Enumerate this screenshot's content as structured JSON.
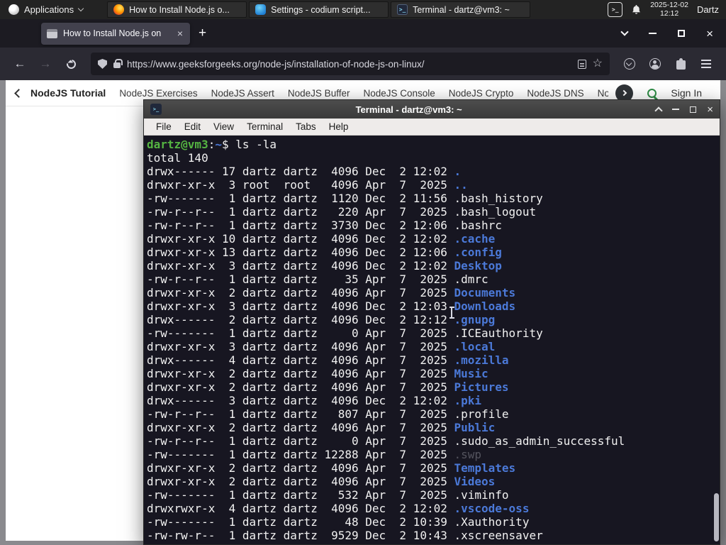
{
  "panel": {
    "applications_label": "Applications",
    "tasks": [
      {
        "title": "How to Install Node.js o...",
        "icon": "firefox-icon"
      },
      {
        "title": "Settings - codium script...",
        "icon": "settings-icon"
      },
      {
        "title": "Terminal - dartz@vm3: ~",
        "icon": "terminal-icon"
      }
    ],
    "clock_date": "2025-12-02",
    "clock_time": "12:12",
    "user_label": "Dartz"
  },
  "browser": {
    "tab": {
      "title": "How to Install Node.js on",
      "close": "×"
    },
    "new_tab": "+",
    "url": "https://www.geeksforgeeks.org/node-js/installation-of-node-js-on-linux/"
  },
  "site_nav": {
    "links": [
      "NodeJS Tutorial",
      "NodeJS Exercises",
      "NodeJS Assert",
      "NodeJS Buffer",
      "NodeJS Console",
      "NodeJS Crypto",
      "NodeJS DNS",
      "Node"
    ],
    "sign_in_label": "Sign In"
  },
  "terminal": {
    "title": "Terminal - dartz@vm3: ~",
    "menu_items": [
      "File",
      "Edit",
      "View",
      "Terminal",
      "Tabs",
      "Help"
    ],
    "prompt": {
      "user": "dartz@vm3",
      "colon": ":",
      "path": "~",
      "dollar": "$",
      "command": " ls -la"
    },
    "total_line": "total 140",
    "listing": [
      {
        "meta": "drwx------ 17 dartz dartz  4096 Dec  2 12:02 ",
        "name": ".",
        "type": "dir"
      },
      {
        "meta": "drwxr-xr-x  3 root  root   4096 Apr  7  2025 ",
        "name": "..",
        "type": "dir"
      },
      {
        "meta": "-rw-------  1 dartz dartz  1120 Dec  2 11:56 ",
        "name": ".bash_history",
        "type": "file"
      },
      {
        "meta": "-rw-r--r--  1 dartz dartz   220 Apr  7  2025 ",
        "name": ".bash_logout",
        "type": "file"
      },
      {
        "meta": "-rw-r--r--  1 dartz dartz  3730 Dec  2 12:06 ",
        "name": ".bashrc",
        "type": "file"
      },
      {
        "meta": "drwxr-xr-x 10 dartz dartz  4096 Dec  2 12:02 ",
        "name": ".cache",
        "type": "dir"
      },
      {
        "meta": "drwxr-xr-x 13 dartz dartz  4096 Dec  2 12:06 ",
        "name": ".config",
        "type": "dir"
      },
      {
        "meta": "drwxr-xr-x  3 dartz dartz  4096 Dec  2 12:02 ",
        "name": "Desktop",
        "type": "dir"
      },
      {
        "meta": "-rw-r--r--  1 dartz dartz    35 Apr  7  2025 ",
        "name": ".dmrc",
        "type": "file"
      },
      {
        "meta": "drwxr-xr-x  2 dartz dartz  4096 Apr  7  2025 ",
        "name": "Documents",
        "type": "dir"
      },
      {
        "meta": "drwxr-xr-x  3 dartz dartz  4096 Dec  2 12:03 ",
        "name": "Downloads",
        "type": "dir"
      },
      {
        "meta": "drwx------  2 dartz dartz  4096 Dec  2 12:12 ",
        "name": ".gnupg",
        "type": "dir"
      },
      {
        "meta": "-rw-------  1 dartz dartz     0 Apr  7  2025 ",
        "name": ".ICEauthority",
        "type": "file"
      },
      {
        "meta": "drwxr-xr-x  3 dartz dartz  4096 Apr  7  2025 ",
        "name": ".local",
        "type": "dir"
      },
      {
        "meta": "drwx------  4 dartz dartz  4096 Apr  7  2025 ",
        "name": ".mozilla",
        "type": "dir"
      },
      {
        "meta": "drwxr-xr-x  2 dartz dartz  4096 Apr  7  2025 ",
        "name": "Music",
        "type": "dir"
      },
      {
        "meta": "drwxr-xr-x  2 dartz dartz  4096 Apr  7  2025 ",
        "name": "Pictures",
        "type": "dir"
      },
      {
        "meta": "drwx------  3 dartz dartz  4096 Dec  2 12:02 ",
        "name": ".pki",
        "type": "dir"
      },
      {
        "meta": "-rw-r--r--  1 dartz dartz   807 Apr  7  2025 ",
        "name": ".profile",
        "type": "file"
      },
      {
        "meta": "drwxr-xr-x  2 dartz dartz  4096 Apr  7  2025 ",
        "name": "Public",
        "type": "dir"
      },
      {
        "meta": "-rw-r--r--  1 dartz dartz     0 Apr  7  2025 ",
        "name": ".sudo_as_admin_successful",
        "type": "file"
      },
      {
        "meta": "-rw-------  1 dartz dartz 12288 Apr  7  2025 ",
        "name": ".swp",
        "type": "dim"
      },
      {
        "meta": "drwxr-xr-x  2 dartz dartz  4096 Apr  7  2025 ",
        "name": "Templates",
        "type": "dir"
      },
      {
        "meta": "drwxr-xr-x  2 dartz dartz  4096 Apr  7  2025 ",
        "name": "Videos",
        "type": "dir"
      },
      {
        "meta": "-rw-------  1 dartz dartz   532 Apr  7  2025 ",
        "name": ".viminfo",
        "type": "file"
      },
      {
        "meta": "drwxrwxr-x  4 dartz dartz  4096 Dec  2 12:02 ",
        "name": ".vscode-oss",
        "type": "dir"
      },
      {
        "meta": "-rw-------  1 dartz dartz    48 Dec  2 10:39 ",
        "name": ".Xauthority",
        "type": "file"
      },
      {
        "meta": "-rw-rw-r--  1 dartz dartz  9529 Dec  2 10:43 ",
        "name": ".xscreensaver",
        "type": "file"
      }
    ]
  },
  "colors": {
    "accent_green": "#2f8d46",
    "dir_blue": "#4b79d8",
    "prompt_green": "#55b442",
    "terminal_bg": "#171621"
  }
}
